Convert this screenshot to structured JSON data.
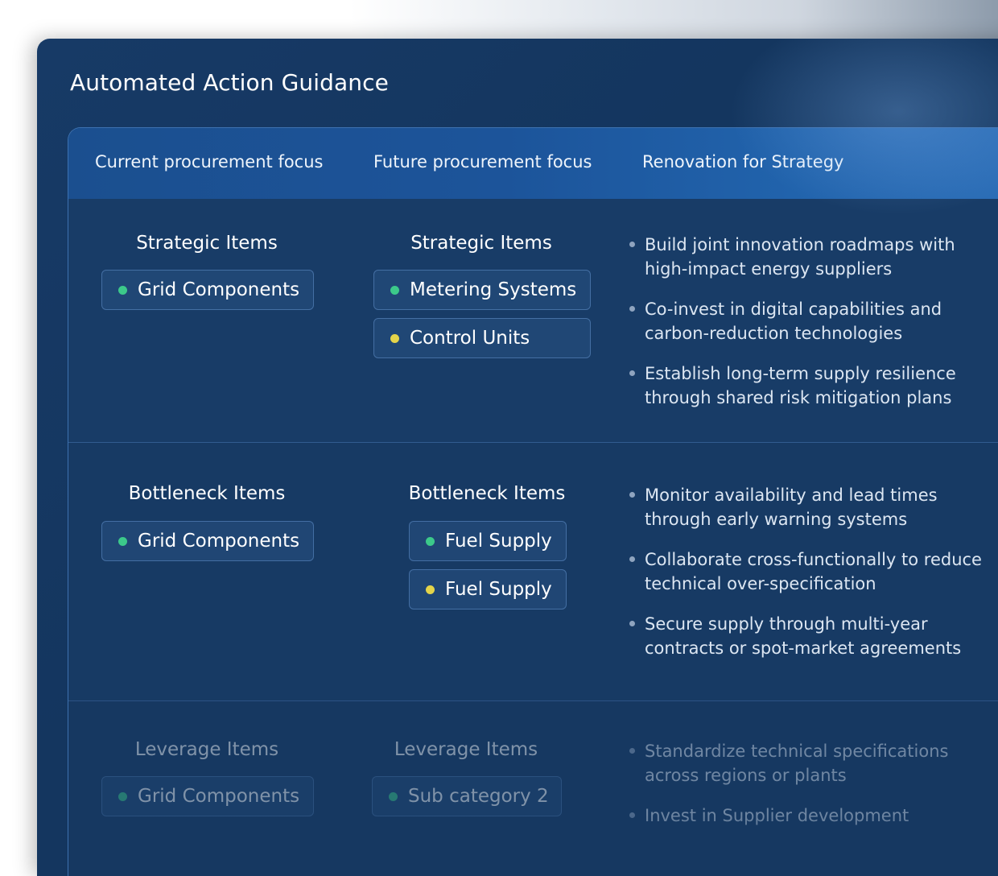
{
  "title": "Automated Action Guidance",
  "columns": [
    "Current procurement focus",
    "Future procurement focus",
    "Renovation for Strategy"
  ],
  "rows": [
    {
      "current_title": "Strategic Items",
      "current_items": [
        {
          "label": "Grid Components",
          "status": "green"
        }
      ],
      "future_title": "Strategic Items",
      "future_items": [
        {
          "label": "Metering Systems",
          "status": "green"
        },
        {
          "label": "Control Units",
          "status": "yellow"
        }
      ],
      "actions": [
        "Build joint innovation roadmaps with high-impact energy suppliers",
        "Co-invest in digital capabilities and carbon-reduction technologies",
        "Establish long-term supply resilience through shared risk mitigation plans"
      ]
    },
    {
      "current_title": "Bottleneck Items",
      "current_items": [
        {
          "label": "Grid Components",
          "status": "green"
        }
      ],
      "future_title": "Bottleneck Items",
      "future_items": [
        {
          "label": "Fuel Supply",
          "status": "green"
        },
        {
          "label": "Fuel Supply",
          "status": "yellow"
        }
      ],
      "actions": [
        "Monitor availability and lead times through early warning systems",
        "Collaborate cross-functionally to reduce technical over-specification",
        "Secure supply through multi-year contracts or spot-market agreements"
      ]
    },
    {
      "current_title": "Leverage Items",
      "current_items": [
        {
          "label": "Grid Components",
          "status": "green"
        }
      ],
      "future_title": "Leverage Items",
      "future_items": [
        {
          "label": "Sub category 2",
          "status": "green"
        }
      ],
      "actions": [
        "Standardize technical specifications across regions or plants",
        "Invest in Supplier development"
      ]
    }
  ],
  "colors": {
    "green": "#3cc98a",
    "yellow": "#e4d44a",
    "accent": "#1c549a"
  }
}
